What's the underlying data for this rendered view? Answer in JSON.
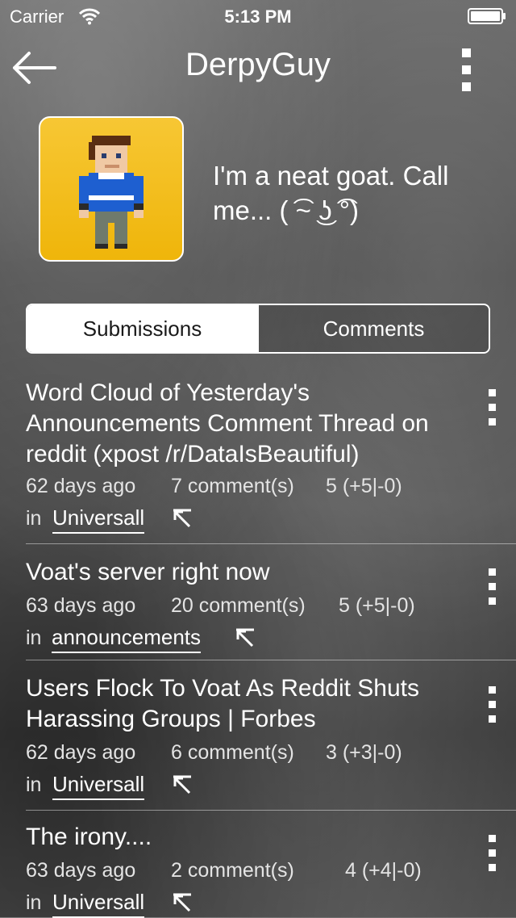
{
  "status": {
    "carrier": "Carrier",
    "time": "5:13 PM"
  },
  "nav": {
    "title": "DerpyGuy"
  },
  "profile": {
    "bio": "I'm a neat goat. Call me... ( ͡~ ͜ʖ ͡°)"
  },
  "tabs": {
    "submissions": "Submissions",
    "comments": "Comments",
    "active": "Submissions"
  },
  "posts": [
    {
      "title": "Word Cloud of Yesterday's Announcements Comment Thread on reddit (xpost /r/DataIsBeautiful)",
      "age": "62 days ago",
      "comments": "7 comment(s)",
      "score": "5 (+5|-0)",
      "in": "in",
      "subverse": "Universall"
    },
    {
      "title": "Voat's server right now",
      "age": "63 days ago",
      "comments": "20 comment(s)",
      "score": "5 (+5|-0)",
      "in": "in",
      "subverse": "announcements"
    },
    {
      "title": "Users Flock To Voat As Reddit Shuts Harassing Groups | Forbes",
      "age": "62 days ago",
      "comments": "6 comment(s)",
      "score": "3 (+3|-0)",
      "in": "in",
      "subverse": "Universall"
    },
    {
      "title": "The irony....",
      "age": "63 days ago",
      "comments": "2 comment(s)",
      "score": "4 (+4|-0)",
      "in": "in",
      "subverse": "Universall"
    }
  ]
}
